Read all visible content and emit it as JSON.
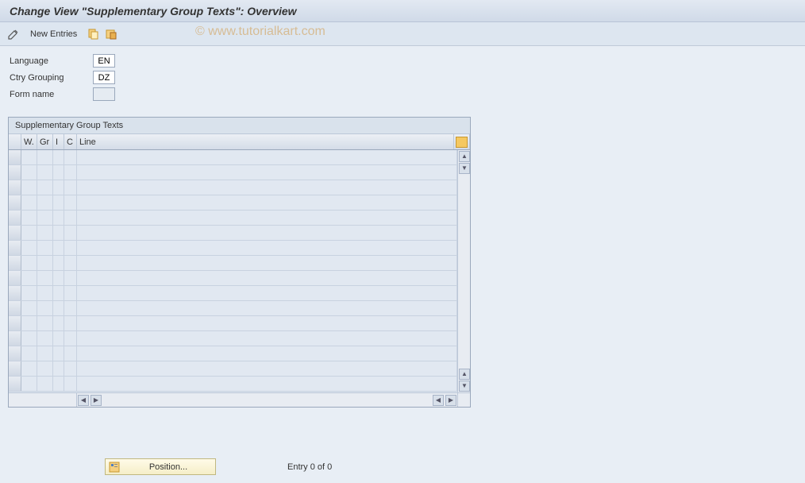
{
  "header": {
    "title": "Change View \"Supplementary Group Texts\": Overview"
  },
  "toolbar": {
    "new_entries_label": "New Entries"
  },
  "watermark": "© www.tutorialkart.com",
  "form": {
    "language_label": "Language",
    "language_value": "EN",
    "ctry_grouping_label": "Ctry Grouping",
    "ctry_grouping_value": "DZ",
    "form_name_label": "Form name",
    "form_name_value": ""
  },
  "grid": {
    "title": "Supplementary Group Texts",
    "columns": {
      "w": "W.",
      "gr": "Gr",
      "i": "I",
      "c": "C",
      "line": "Line"
    }
  },
  "footer": {
    "position_label": "Position...",
    "entry_text": "Entry 0 of 0"
  }
}
